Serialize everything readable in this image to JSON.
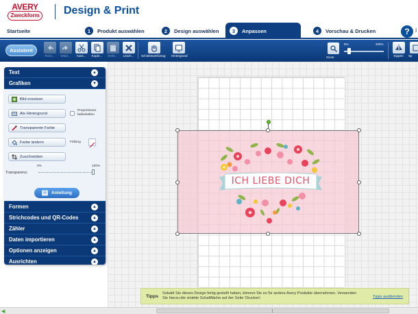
{
  "header": {
    "brand_top": "AVERY",
    "brand_bottom": "Zweckform",
    "title": "Design & Print"
  },
  "nav": {
    "home": "Startseite",
    "steps": [
      {
        "num": "1",
        "label": "Produkt auswählen"
      },
      {
        "num": "2",
        "label": "Design auswählen"
      },
      {
        "num": "3",
        "label": "Anpassen"
      },
      {
        "num": "4",
        "label": "Vorschau & Drucken"
      }
    ],
    "help": "?",
    "help_cut": "I"
  },
  "toolbar": {
    "assistent": "Assistent",
    "tools": [
      {
        "label": "Rück...",
        "icon": "undo-icon",
        "enabled": false
      },
      {
        "label": "Wied...",
        "icon": "redo-icon",
        "enabled": false
      },
      {
        "label": "Auss...",
        "icon": "scissors-icon",
        "enabled": true
      },
      {
        "label": "Kopie...",
        "icon": "copy-icon",
        "enabled": true
      },
      {
        "label": "Einfü...",
        "icon": "paste-icon",
        "enabled": false
      },
      {
        "label": "Lösch...",
        "icon": "delete-icon",
        "enabled": true
      }
    ],
    "pan_label": "Schiebewerkzeug",
    "background_label": "Hintergrund",
    "zoom_label": "Zoom",
    "zoom_min": "5%",
    "zoom_max": "400%",
    "zoom_level_fraction": 0.12,
    "flip_label": "Kippen",
    "more_label": "Sp"
  },
  "panel": {
    "sections_top": [
      {
        "label": "Text",
        "expanded": false
      },
      {
        "label": "Grafiken",
        "expanded": true
      }
    ],
    "grafiken": {
      "replace_image": "Bild ersetzen",
      "as_background": "Als Hintergrund",
      "keep_proportions": "Proportionen beibehalten",
      "transparent_color": "Transparente Farbe",
      "change_color": "Farbe ändern",
      "fill_label": "Füllung",
      "crop": "Zuschneiden",
      "transparency_label": "Transparenz:",
      "transparency_min": "0%",
      "transparency_max": "100%",
      "transparency_value_fraction": 0.98,
      "guide": "Anleitung"
    },
    "sections_bottom": [
      {
        "label": "Formen"
      },
      {
        "label": "Strichcodes und QR-Codes"
      },
      {
        "label": "Zähler"
      },
      {
        "label": "Daten importieren"
      },
      {
        "label": "Optionen anzeigen"
      },
      {
        "label": "Ausrichten"
      }
    ]
  },
  "canvas": {
    "banner_text": "ICH LIEBE DICH"
  },
  "tips": {
    "label": "Tipps",
    "text": "Sobald Sie dieses Design fertig gestellt haben, können Sie es für andere Avery Produkte übernehmen.  Verwenden Sie hierzu die violette Schaltfläche auf der Seite 'Drucken'.",
    "hide": "Tipps ausblenden"
  },
  "colors": {
    "brand_red": "#c8102e",
    "brand_blue": "#0b4f9c",
    "nav_dark": "#0d3f82",
    "panel_dark": "#0b3876",
    "tips_bg": "#dfeba6",
    "banner_text": "#e0546b"
  }
}
